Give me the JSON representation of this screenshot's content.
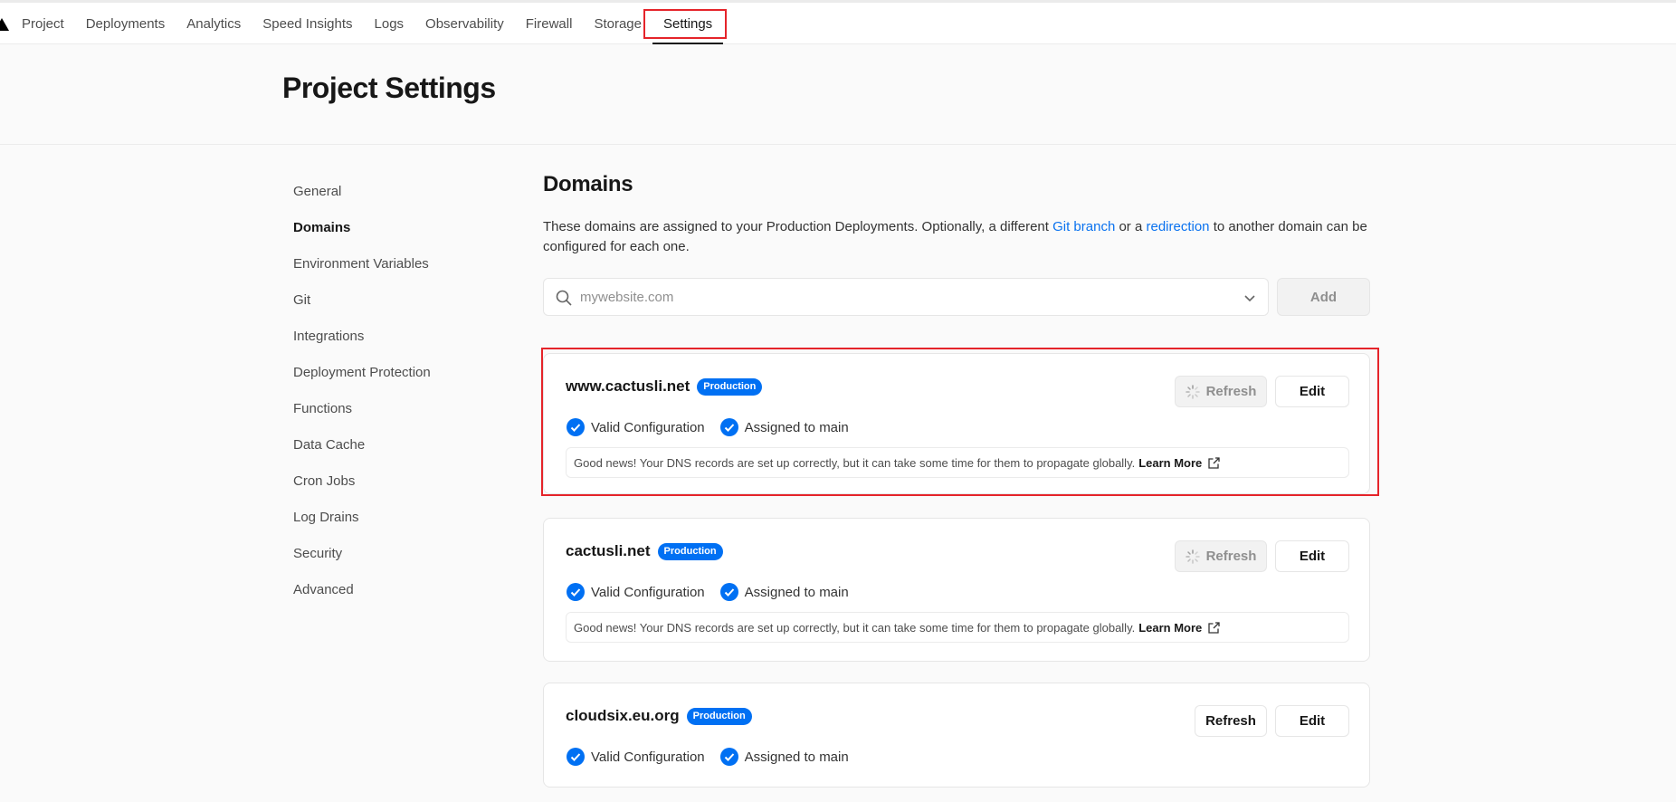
{
  "nav": {
    "tabs": [
      {
        "label": "Project"
      },
      {
        "label": "Deployments"
      },
      {
        "label": "Analytics"
      },
      {
        "label": "Speed Insights"
      },
      {
        "label": "Logs"
      },
      {
        "label": "Observability"
      },
      {
        "label": "Firewall"
      },
      {
        "label": "Storage"
      },
      {
        "label": "Settings"
      }
    ],
    "active_tab": "Settings"
  },
  "header": {
    "title": "Project Settings"
  },
  "sidebar": {
    "items": [
      {
        "label": "General"
      },
      {
        "label": "Domains"
      },
      {
        "label": "Environment Variables"
      },
      {
        "label": "Git"
      },
      {
        "label": "Integrations"
      },
      {
        "label": "Deployment Protection"
      },
      {
        "label": "Functions"
      },
      {
        "label": "Data Cache"
      },
      {
        "label": "Cron Jobs"
      },
      {
        "label": "Log Drains"
      },
      {
        "label": "Security"
      },
      {
        "label": "Advanced"
      }
    ],
    "active_item": "Domains"
  },
  "domains": {
    "title": "Domains",
    "description_part1": "These domains are assigned to your Production Deployments. Optionally, a different ",
    "git_branch_link": "Git branch",
    "description_part2": " or a ",
    "redirection_link": "redirection",
    "description_part3": " to another domain can be configured for each one.",
    "input_placeholder": "mywebsite.com",
    "add_label": "Add",
    "cards": [
      {
        "domain": "www.cactusli.net",
        "badge": "Production",
        "valid_label": "Valid Configuration",
        "assigned_label": "Assigned to main",
        "refresh_label": "Refresh",
        "refresh_loading": true,
        "edit_label": "Edit",
        "info_text": "Good news! Your DNS records are set up correctly, but it can take some time for them to propagate globally.",
        "learn_more": "Learn More"
      },
      {
        "domain": "cactusli.net",
        "badge": "Production",
        "valid_label": "Valid Configuration",
        "assigned_label": "Assigned to main",
        "refresh_label": "Refresh",
        "refresh_loading": true,
        "edit_label": "Edit",
        "info_text": "Good news! Your DNS records are set up correctly, but it can take some time for them to propagate globally.",
        "learn_more": "Learn More"
      },
      {
        "domain": "cloudsix.eu.org",
        "badge": "Production",
        "valid_label": "Valid Configuration",
        "assigned_label": "Assigned to main",
        "refresh_label": "Refresh",
        "refresh_loading": false,
        "edit_label": "Edit"
      }
    ]
  },
  "colors": {
    "accent": "#0070f3",
    "link": "#0a72ef",
    "highlight": "#e5242a"
  }
}
